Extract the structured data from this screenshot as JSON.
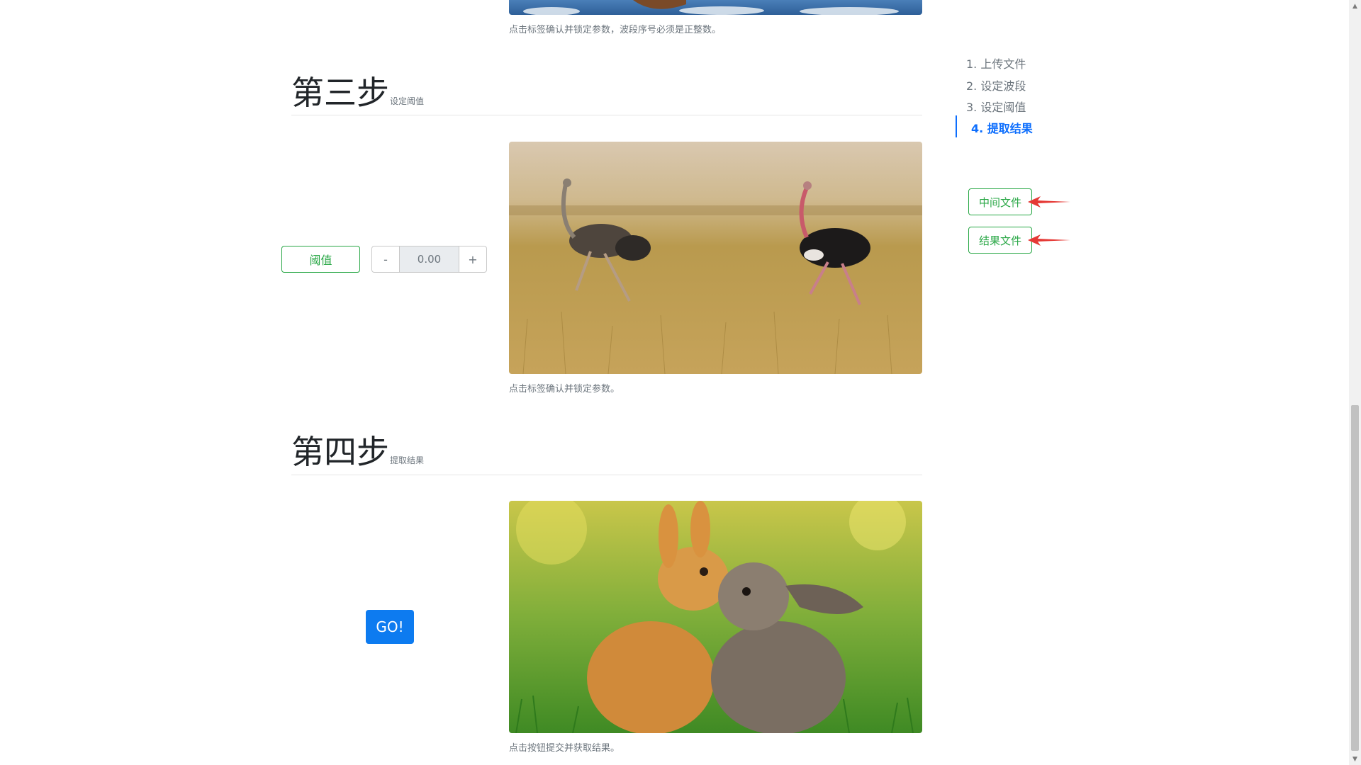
{
  "top_image": {
    "caption": "点击标签确认并锁定参数，波段序号必须是正整数。"
  },
  "step3": {
    "title": "第三步",
    "subtitle": "设定阈值",
    "threshold_button": "阈值",
    "minus": "-",
    "value": "0.00",
    "plus": "+",
    "caption": "点击标签确认并锁定参数。"
  },
  "step4": {
    "title": "第四步",
    "subtitle": "提取结果",
    "go_button": "GO!",
    "caption": "点击按钮提交并获取结果。"
  },
  "nav": {
    "items": [
      {
        "label": "1. 上传文件"
      },
      {
        "label": "2. 设定波段"
      },
      {
        "label": "3. 设定阈值"
      },
      {
        "label": "4. 提取结果"
      }
    ]
  },
  "files": {
    "intermediate": "中间文件",
    "result": "结果文件"
  },
  "colors": {
    "accent_green": "#28a745",
    "accent_blue": "#0d6efd",
    "annotation_red": "#e53935"
  }
}
